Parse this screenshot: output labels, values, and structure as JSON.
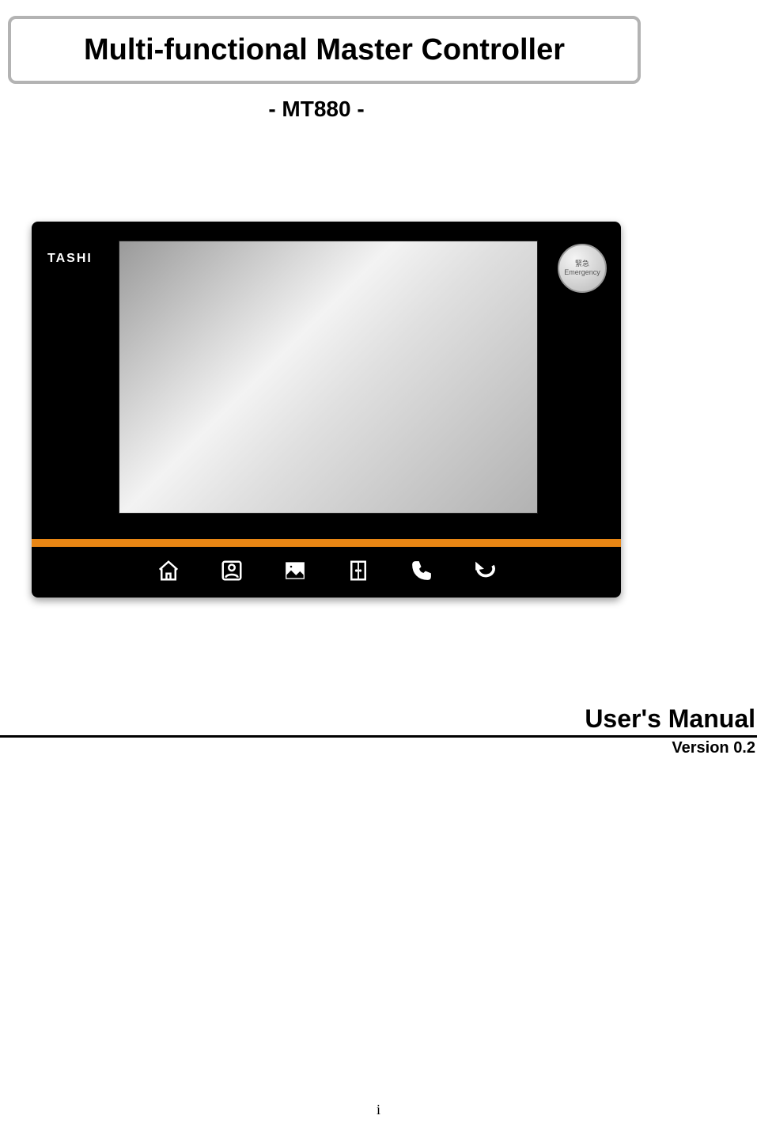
{
  "title": "Multi-functional Master Controller",
  "subtitle": "- MT880 -",
  "device": {
    "brand": "TASHI",
    "emergency": {
      "line1": "緊急",
      "line2": "Emergency"
    },
    "nav": {
      "home": "home-icon",
      "user": "user-icon",
      "image": "image-icon",
      "door": "door-icon",
      "phone": "phone-icon",
      "back": "back-icon"
    }
  },
  "manual": {
    "heading": "User's  Manual",
    "version": "Version 0.2"
  },
  "page_number": "i"
}
